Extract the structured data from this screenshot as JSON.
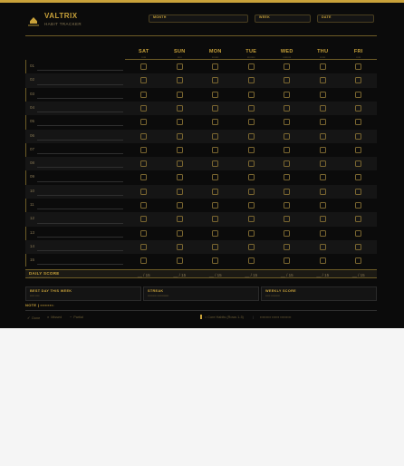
{
  "header": {
    "brand": "VALTRIX",
    "tagline": "HABIT TRACKER",
    "fields": [
      {
        "label": "MONTH"
      },
      {
        "label": "WEEK"
      },
      {
        "label": "DATE"
      }
    ]
  },
  "days": [
    {
      "name": "SAT",
      "date": "▪▪▪▪"
    },
    {
      "name": "SUN",
      "date": "▪▪▪▪"
    },
    {
      "name": "MON",
      "date": "▪▪▪▪▪▪"
    },
    {
      "name": "TUE",
      "date": "▪▪▪▪▪▪▪"
    },
    {
      "name": "WED",
      "date": "▪▪▪▪▪▪▪"
    },
    {
      "name": "THU",
      "date": "▪▪▪▪▪"
    },
    {
      "name": "FRI",
      "date": "▪▪▪▪"
    }
  ],
  "habits": [
    "01",
    "02",
    "03",
    "04",
    "05",
    "06",
    "07",
    "08",
    "09",
    "10",
    "11",
    "12",
    "13",
    "14",
    "15"
  ],
  "daily_score": {
    "label": "DAILY SCORE",
    "sublabel": "▪▪▪▪▪▪▪▪▪▪▪▪▪▪▪▪▪▪▪▪▪▪",
    "values": [
      "__ / 15",
      "__ / 15",
      "__ / 15",
      "__ / 15",
      "__ / 15",
      "__ / 15",
      "__ / 15"
    ]
  },
  "cards": [
    {
      "title": "BEST DAY THIS WEEK",
      "sub": "▪▪▪▪▪ ▪▪▪▪"
    },
    {
      "title": "STREAK",
      "sub": "▪▪▪▪▪▪▪▪▪ ▪▪▪▪▪▪▪▪▪▪▪▪"
    },
    {
      "title": "WEEKLY SCORE",
      "sub": "▪▪▪▪▪ ▪▪▪▪▪▪▪▪▪"
    }
  ],
  "note": {
    "label": "NOTE | ▪▪▪▪▪▪▪▪:"
  },
  "legend": {
    "done": {
      "sym": "✓",
      "text": "Done"
    },
    "missed": {
      "sym": "×",
      "text": "Missed"
    },
    "partial": {
      "sym": "~",
      "text": "Partial"
    },
    "core": "= Core Habits (Rows 1-5)",
    "sep": "|",
    "extra": "▪▪▪▪▪▪▪▪▪ ▪▪▪▪▪▪ ▪▪▪▪▪▪▪▪▪"
  },
  "colors": {
    "accent": "#c9a23a",
    "background": "#0b0b0b",
    "page": "#f5f5f5"
  }
}
